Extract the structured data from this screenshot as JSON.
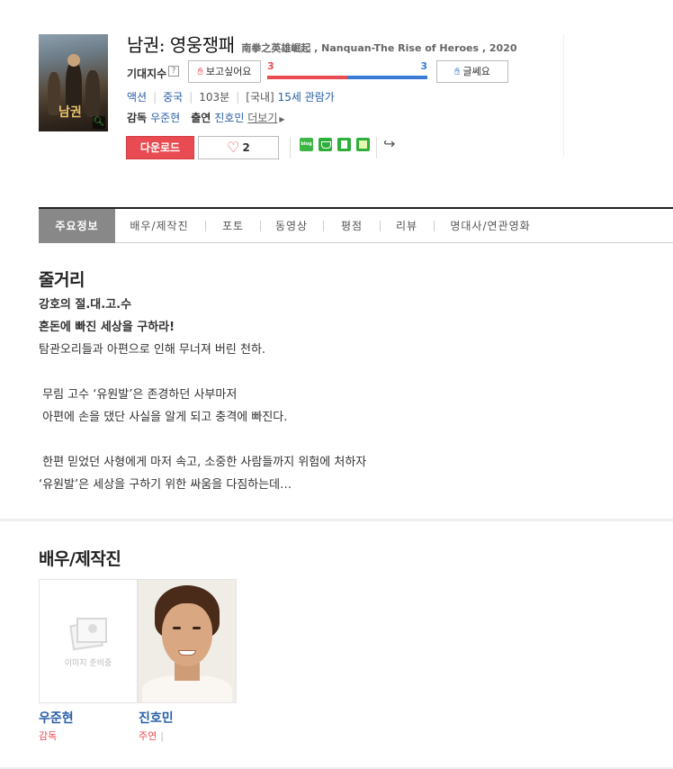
{
  "movie": {
    "title": "남권: 영웅쟁패",
    "subtitle": "南拳之英雄崛起 , Nanquan-The Rise of Heroes , 2020",
    "poster_title": "남권"
  },
  "rating": {
    "label": "기대지수",
    "help": "?",
    "want_label": "보고싶어요",
    "want_count": "3",
    "nope_count": "3",
    "want_ratio": 0.5,
    "nope_label": "글쎄요"
  },
  "meta": {
    "genre": "액션",
    "country": "중국",
    "runtime": "103분",
    "region": "[국내]",
    "age": "15세 관람가"
  },
  "credits": {
    "director_label": "감독",
    "director": "우준현",
    "cast_label": "출연",
    "cast": "진호민",
    "more": "더보기"
  },
  "actions": {
    "download": "다운로드",
    "like_count": "2",
    "blog": "blog"
  },
  "tabs": [
    {
      "label": "주요정보",
      "active": true
    },
    {
      "label": "배우/제작진"
    },
    {
      "label": "포토"
    },
    {
      "label": "동영상"
    },
    {
      "label": "평점"
    },
    {
      "label": "리뷰"
    },
    {
      "label": "명대사/연관영화"
    }
  ],
  "synopsis": {
    "heading": "줄거리",
    "line1": "강호의 절.대.고.수",
    "line2": "혼돈에 빠진 세상을 구하라!",
    "line3": "탐관오리들과 아편으로 인해 무너져 버린 천하.",
    "line4": " 무림 고수 ‘유원발’은 존경하던 사부마저",
    "line5": " 아편에 손을 댔단 사실을 알게 되고 충격에 빠진다.",
    "line6": " 한편 믿었던 사형에게 마저 속고, 소중한 사람들까지 위험에 처하자",
    "line7": "‘유원발’은 세상을 구하기 위한 싸움을 다짐하는데…"
  },
  "cast_section": {
    "heading": "배우/제작진",
    "noimage_text": "이미지 준비중",
    "people": [
      {
        "name": "우준현",
        "role": "감독"
      },
      {
        "name": "진호민",
        "role": "주연"
      }
    ]
  },
  "colors": {
    "accent_red": "#e94b52",
    "link_blue": "#2a5fa8",
    "gauge_blue": "#3a7bd5"
  }
}
